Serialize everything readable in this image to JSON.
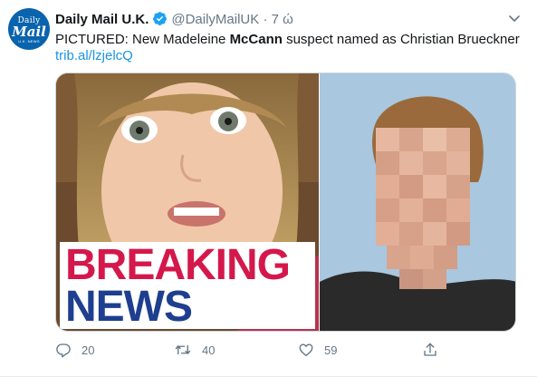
{
  "account": {
    "display_name": "Daily Mail U.K.",
    "handle": "@DailyMailUK",
    "separator": "·",
    "time": "7 ώ",
    "avatar": {
      "line1": "Daily",
      "line2": "Mail",
      "line3": "U.K. NEWS"
    }
  },
  "tweet": {
    "text_before": "PICTURED: New Madeleine ",
    "text_bold": "McCann",
    "text_after": " suspect named as Christian Brueckner",
    "link": "trib.al/lzjelcQ"
  },
  "media": {
    "overlay_line1": "BREAKING",
    "overlay_line2": "NEWS",
    "colors": {
      "breaking": "#d4184b",
      "news": "#1e3f8f"
    }
  },
  "actions": {
    "replies": "20",
    "retweets": "40",
    "likes": "59"
  },
  "icons": [
    "verified-badge-icon",
    "chevron-down-icon",
    "reply-icon",
    "retweet-icon",
    "like-icon",
    "share-icon"
  ],
  "colors": {
    "link": "#1b95e0",
    "muted": "#657786",
    "verified": "#1da1f2"
  }
}
